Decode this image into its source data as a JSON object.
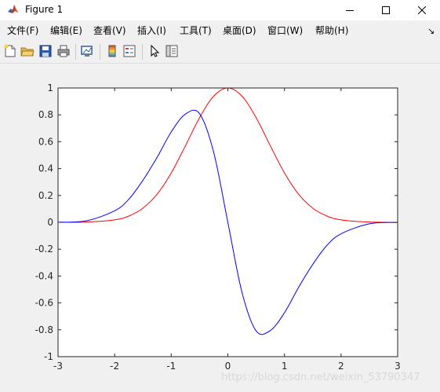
{
  "window": {
    "title": "Figure 1",
    "icon": "matlab-icon"
  },
  "menu": {
    "items": [
      {
        "label": "文件(F)"
      },
      {
        "label": "编辑(E)"
      },
      {
        "label": "查看(V)"
      },
      {
        "label": "插入(I)"
      },
      {
        "label": "工具(T)"
      },
      {
        "label": "桌面(D)"
      },
      {
        "label": "窗口(W)"
      },
      {
        "label": "帮助(H)"
      }
    ],
    "overflow_icon": "dock-arrow-icon"
  },
  "toolbar": {
    "buttons": [
      "new-figure-icon",
      "open-file-icon",
      "save-icon",
      "print-icon",
      "link-plot-icon",
      "insert-colorbar-icon",
      "insert-legend-icon",
      "edit-plot-icon",
      "property-inspector-icon"
    ]
  },
  "watermark": "https://blog.csdn.net/weixin_53790347",
  "chart_data": {
    "type": "line",
    "title": "",
    "xlabel": "",
    "ylabel": "",
    "xlim": [
      -3,
      3
    ],
    "ylim": [
      -1,
      1
    ],
    "xticks": [
      -3,
      -2,
      -1,
      0,
      1,
      2,
      3
    ],
    "yticks": [
      -1,
      -0.8,
      -0.6,
      -0.4,
      -0.2,
      0,
      0.2,
      0.4,
      0.6,
      0.8,
      1
    ],
    "xtick_labels": [
      "-3",
      "-2",
      "-1",
      "0",
      "1",
      "2",
      "3"
    ],
    "ytick_labels": [
      "-1",
      "-0.8",
      "-0.6",
      "-0.4",
      "-0.2",
      "0",
      "0.2",
      "0.4",
      "0.6",
      "0.8",
      "1"
    ],
    "grid": false,
    "series": [
      {
        "color": "#ff0000",
        "x": [
          -3,
          -2.5,
          -2,
          -1.75,
          -1.5,
          -1.25,
          -1,
          -0.75,
          -0.5,
          -0.25,
          0,
          0.25,
          0.5,
          0.75,
          1,
          1.25,
          1.5,
          1.75,
          2,
          2.5,
          3
        ],
        "y": [
          0.0001,
          0.0019,
          0.0183,
          0.0468,
          0.1054,
          0.2096,
          0.3679,
          0.5698,
          0.7788,
          0.9394,
          1.0,
          0.9394,
          0.7788,
          0.5698,
          0.3679,
          0.2096,
          0.1054,
          0.0468,
          0.0183,
          0.0019,
          0.0001
        ]
      },
      {
        "color": "#0000ff",
        "x": [
          -3,
          -2.5,
          -2,
          -1.75,
          -1.5,
          -1.25,
          -1,
          -0.75,
          -0.5,
          -0.25,
          0,
          0.25,
          0.5,
          0.75,
          1,
          1.25,
          1.5,
          1.75,
          2,
          2.5,
          3
        ],
        "y": [
          0.0007,
          0.0112,
          0.0856,
          0.1717,
          0.3131,
          0.4839,
          0.6733,
          0.8059,
          0.8091,
          0.5214,
          0.0,
          -0.5214,
          -0.8091,
          -0.8059,
          -0.6733,
          -0.4839,
          -0.3131,
          -0.1717,
          -0.0856,
          -0.0112,
          -0.0007
        ]
      }
    ]
  }
}
